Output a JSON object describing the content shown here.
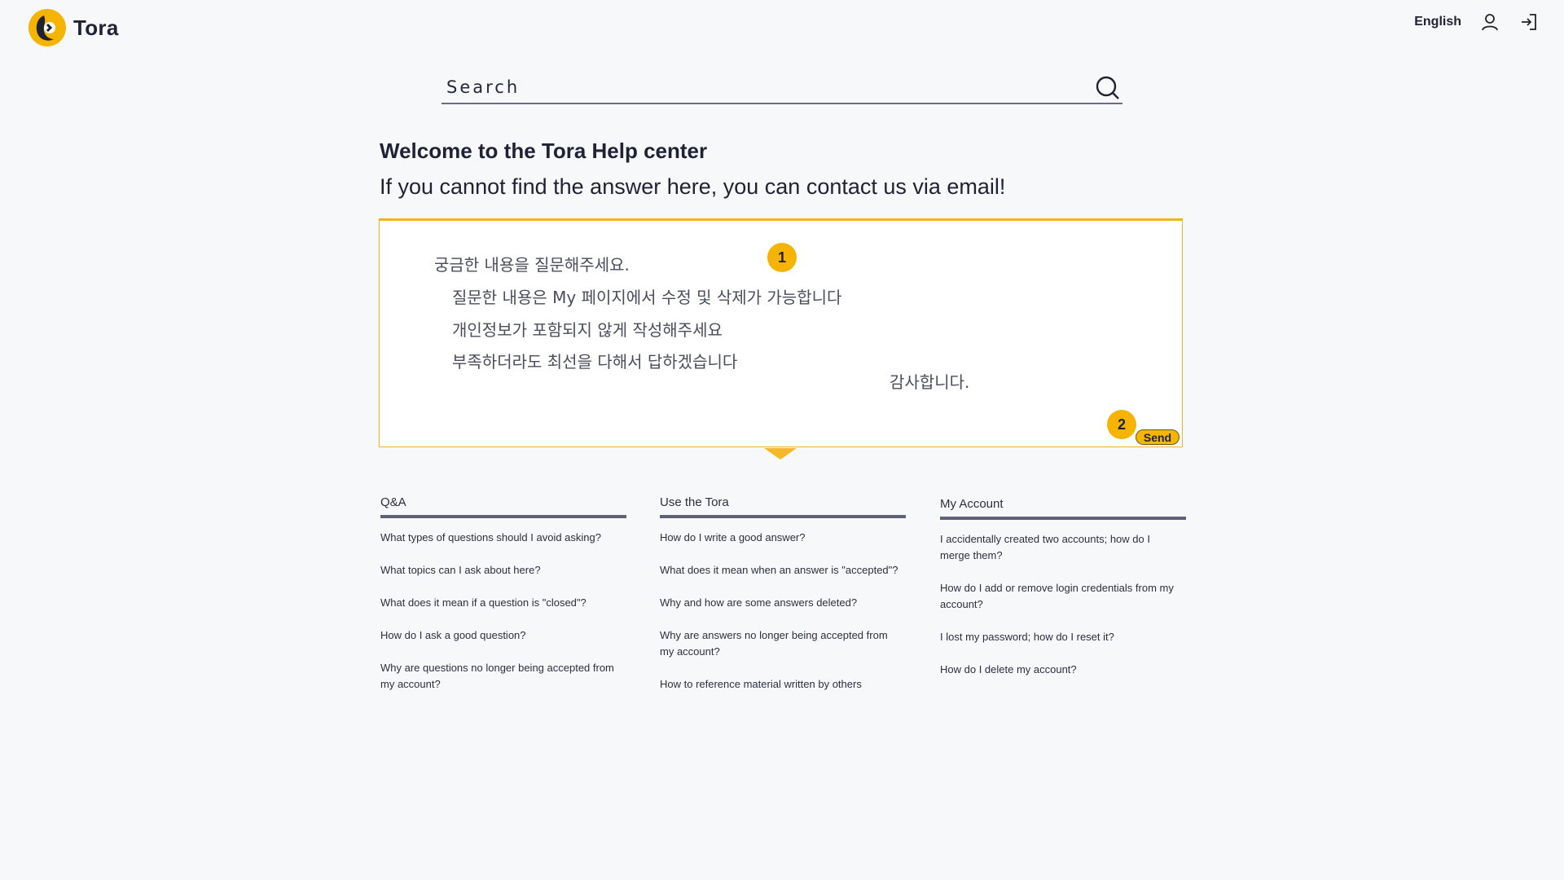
{
  "brand": {
    "name": "Tora",
    "logo_icon": "tora-logo-icon",
    "accent": "#f5b400"
  },
  "header": {
    "language": "English",
    "user_icon": "user-icon",
    "login_icon": "sign-in-icon"
  },
  "search": {
    "placeholder": "Search",
    "icon": "search-icon"
  },
  "hero": {
    "title": "Welcome to the Tora Help center",
    "subtitle": "If you cannot find the answer here, you can contact us via email!"
  },
  "question_box": {
    "lines": [
      "궁금한 내용을 질문해주세요.",
      "질문한 내용은 My 페이지에서 수정 및 삭제가 가능합니다",
      "개인정보가 포함되지 않게 작성해주세요",
      "부족하더라도 최선을 다해서 답하겠습니다",
      "감사합니다."
    ],
    "badge_1": "1",
    "badge_2": "2",
    "send_label": "Send"
  },
  "faq_columns": [
    {
      "title": "Q&A",
      "items": [
        "What types of questions should I avoid asking?",
        "What topics can I ask about here?",
        "What does it mean if a question is \"closed\"?",
        "How do I ask a good question?",
        "Why are questions no longer being accepted from my account?"
      ]
    },
    {
      "title": "Use the Tora",
      "items": [
        "How do I write a good answer?",
        "What does it mean when an answer is \"accepted\"?",
        "Why and how are some answers deleted?",
        "Why are answers no longer being accepted from my account?",
        "How to reference material written by others"
      ]
    },
    {
      "title": "My Account",
      "items": [
        "I accidentally created two accounts; how do I merge them?",
        "How do I add or remove login credentials from my account?",
        "I lost my password; how do I reset it?",
        "How do I delete my account?"
      ]
    }
  ]
}
